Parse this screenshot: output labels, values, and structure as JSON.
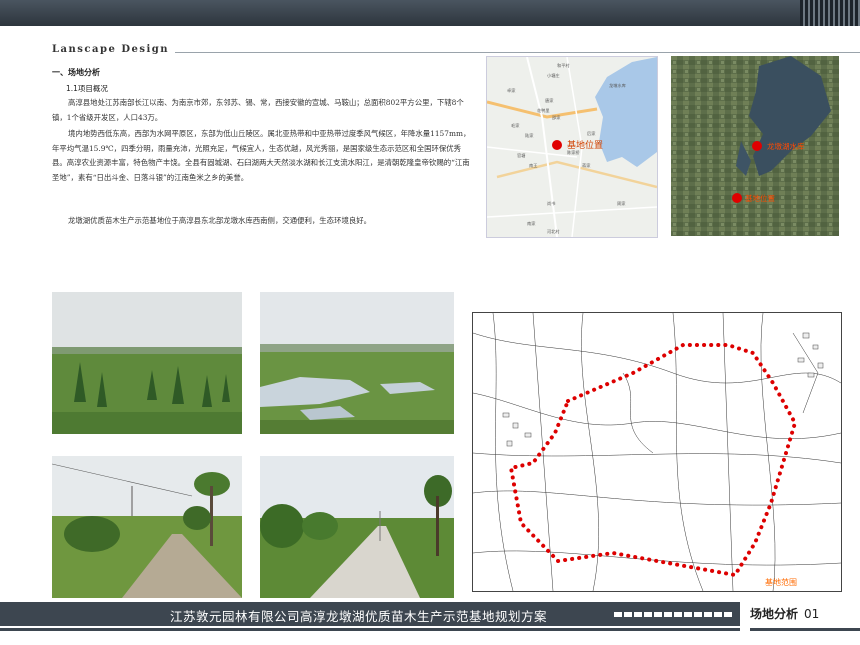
{
  "header": {
    "section_heading": "Lanscape Design"
  },
  "content": {
    "section_title": "一、场地分析",
    "subsection_title": "1.1项目概况",
    "paragraphs": [
      "高淳县地处江苏南部长江以南、为南京市郊，东邻苏、锡、常，西接安徽的宣城、马鞍山；总面积802平方公里，下辖8个镇，1个省级开发区，人口43万。",
      "境内地势西低东高，西部为水网平原区，东部为低山丘陵区。属北亚热带和中亚热带过度季风气候区，年降水量1157mm，年平均气温15.9℃，四季分明，雨量充沛，光照充足，气候宜人，生态优越，风光秀丽，是国家级生态示范区和全国环保优秀县。高淳农业资源丰富，特色物产丰饶。全县有固城湖、石臼湖两大天然淡水湖和长江支流水阳江，是清朝乾隆皇帝钦赐的“江南圣地”，素有“日出斗金、日落斗银”的江南鱼米之乡的美誉。",
      "龙墩湖优质苗木生产示范基地位于高淳县东北部龙墩水库西南侧，交通便利，生态环境良好。"
    ]
  },
  "location_map": {
    "marker_label": "基地位置",
    "marker_color": "#e00000",
    "small_labels": [
      "和平村",
      "小塘庄",
      "龙墩水库",
      "卓家",
      "唐家",
      "花鸭里",
      "邵家",
      "毛家",
      "陆家",
      "后家",
      "陈家桥",
      "官塘",
      "南王",
      "蒋家",
      "周家",
      "尚书",
      "南家",
      "河北村"
    ]
  },
  "satellite_map": {
    "labels": [
      "龙墩湖水库",
      "基地位置"
    ],
    "marker_color": "#e00000"
  },
  "site_plan": {
    "boundary_label": "基地范围",
    "boundary_color": "#dd0000"
  },
  "photos": [
    {
      "name": "site-photo-grassland"
    },
    {
      "name": "site-photo-pond"
    },
    {
      "name": "site-photo-road-left"
    },
    {
      "name": "site-photo-road-center"
    }
  ],
  "footer": {
    "project_title": "江苏敦元园林有限公司高淳龙墩湖优质苗木生产示范基地规划方案",
    "page_label": "场地分析",
    "page_number": "01"
  },
  "colors": {
    "dark_band": "#3d4650",
    "marker": "#e00000"
  }
}
